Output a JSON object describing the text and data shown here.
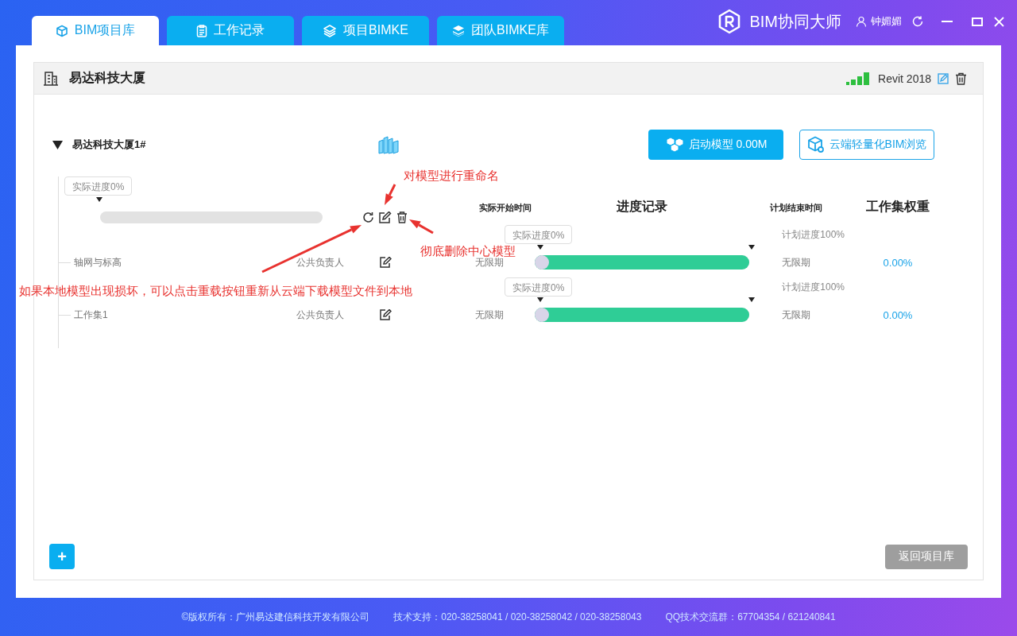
{
  "tabs": [
    {
      "label": "BIM项目库",
      "selected": true
    },
    {
      "label": "工作记录",
      "selected": false
    },
    {
      "label": "项目BIMKE",
      "selected": false
    },
    {
      "label": "团队BIMKE库",
      "selected": false
    }
  ],
  "app_title": "BIM协同大师",
  "user": {
    "name": "钟媚媚"
  },
  "project": {
    "title": "易达科技大厦",
    "software": "Revit 2018"
  },
  "model": {
    "name": "易达科技大厦1#",
    "expanded": true,
    "progress_label": "实际进度0%",
    "level": 0,
    "launch_button": "启动模型 0.00M",
    "browse_button": "云端轻量化BIM浏览"
  },
  "columns": [
    {
      "label": "实际开始时间",
      "kind": "minor"
    },
    {
      "label": "进度记录",
      "kind": "major"
    },
    {
      "label": "计划结束时间",
      "kind": "minor"
    },
    {
      "label": "工作集权重",
      "kind": "major"
    }
  ],
  "worksets": [
    {
      "name": "轴网与标高",
      "owner": "公共负责人",
      "start": "无限期",
      "actual_label": "实际进度0%",
      "plan_label": "计划进度100%",
      "level": 1,
      "end": "无限期",
      "weight": "0.00%"
    },
    {
      "name": "工作集1",
      "owner": "公共负责人",
      "start": "无限期",
      "actual_label": "实际进度0%",
      "plan_label": "计划进度100%",
      "level": 1,
      "end": "无限期",
      "weight": "0.00%"
    }
  ],
  "add_button": "+",
  "back_button": "返回项目库",
  "footer": [
    "©版权所有：广州易达建信科技开发有限公司",
    "技术支持：020-38258041 / 020-38258042 / 020-38258043",
    "QQ技术交流群：67704354 / 621240841"
  ],
  "annotations": [
    "对模型进行重命名",
    "彻底删除中心模型",
    "如果本地模型出现损坏，可以点击重载按钮重新从云端下载模型文件到本地"
  ]
}
